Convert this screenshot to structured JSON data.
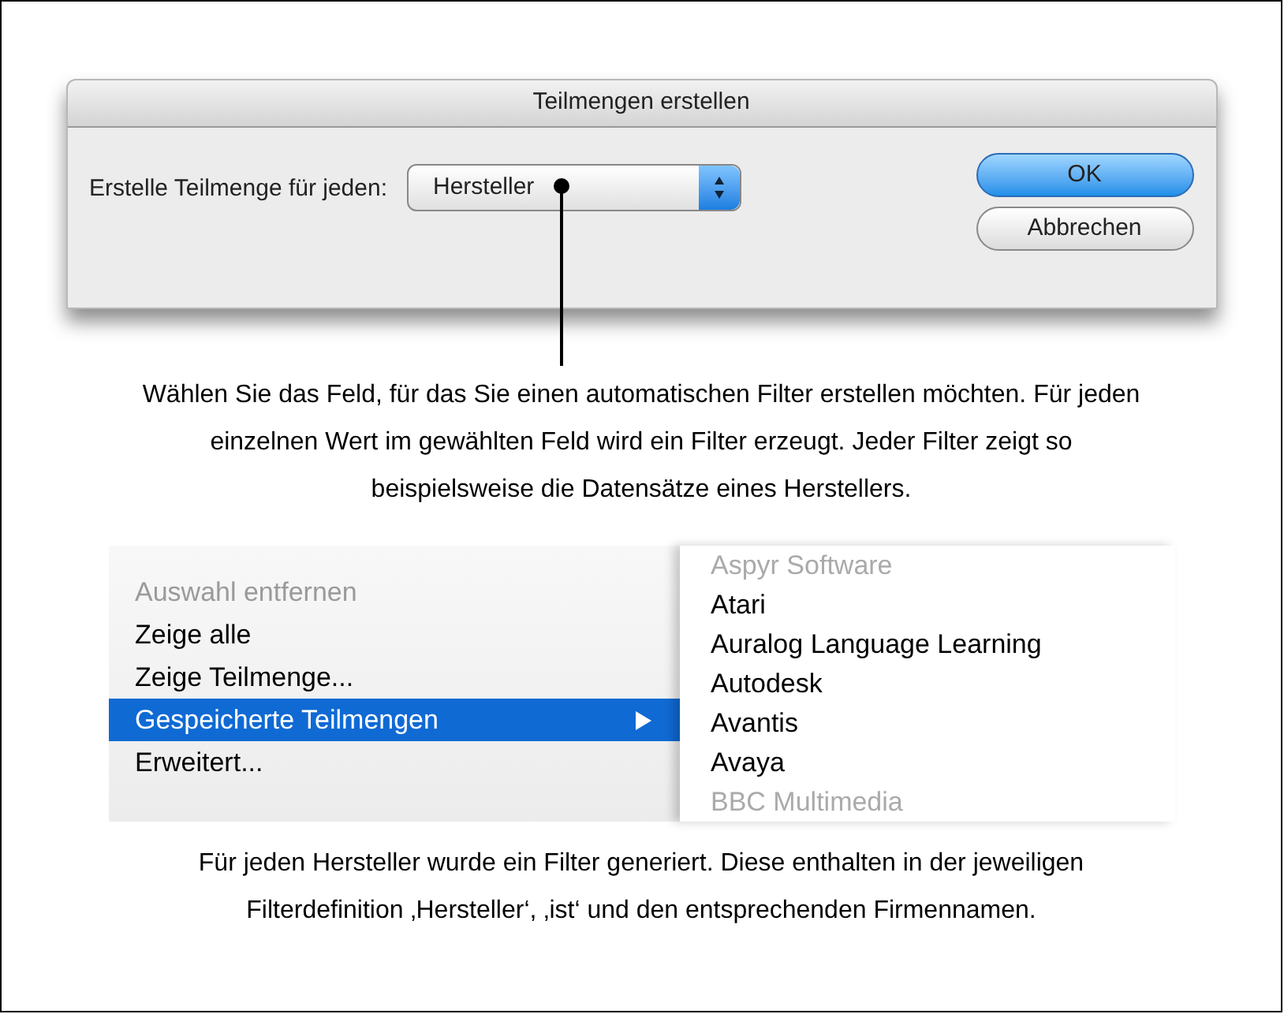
{
  "dialog": {
    "title": "Teilmengen erstellen",
    "label": "Erstelle Teilmenge für jeden:",
    "popup_value": "Hersteller",
    "buttons": [
      {
        "label": "OK",
        "default": true
      },
      {
        "label": "Abbrechen",
        "default": false
      }
    ]
  },
  "caption_1": "Wählen Sie das Feld, für das Sie einen automatischen Filter erstellen möchten. Für jeden einzelnen Wert im gewählten Feld wird ein Filter erzeugt. Jeder Filter zeigt so beispielsweise die Datensätze eines Herstellers.",
  "menu": {
    "items": [
      {
        "label": "Auswahl entfernen",
        "disabled": true,
        "selected": false,
        "submenu": false
      },
      {
        "label": "Zeige alle",
        "disabled": false,
        "selected": false,
        "submenu": false
      },
      {
        "label": "Zeige Teilmenge...",
        "disabled": false,
        "selected": false,
        "submenu": false
      },
      {
        "label": "Gespeicherte Teilmengen",
        "disabled": false,
        "selected": true,
        "submenu": true
      },
      {
        "label": "Erweitert...",
        "disabled": false,
        "selected": false,
        "submenu": false
      }
    ]
  },
  "submenu": {
    "items": [
      {
        "label": "Aspyr Software",
        "faded": true
      },
      {
        "label": "Atari",
        "faded": false
      },
      {
        "label": "Auralog Language Learning",
        "faded": false
      },
      {
        "label": "Autodesk",
        "faded": false
      },
      {
        "label": "Avantis",
        "faded": false
      },
      {
        "label": "Avaya",
        "faded": false
      },
      {
        "label": "BBC Multimedia",
        "faded": true
      }
    ]
  },
  "caption_2": "Für jeden Hersteller wurde ein Filter generiert. Diese enthalten in der jeweiligen Filterdefinition ‚Hersteller‘, ‚ist‘ und den entsprechenden Firmennamen."
}
